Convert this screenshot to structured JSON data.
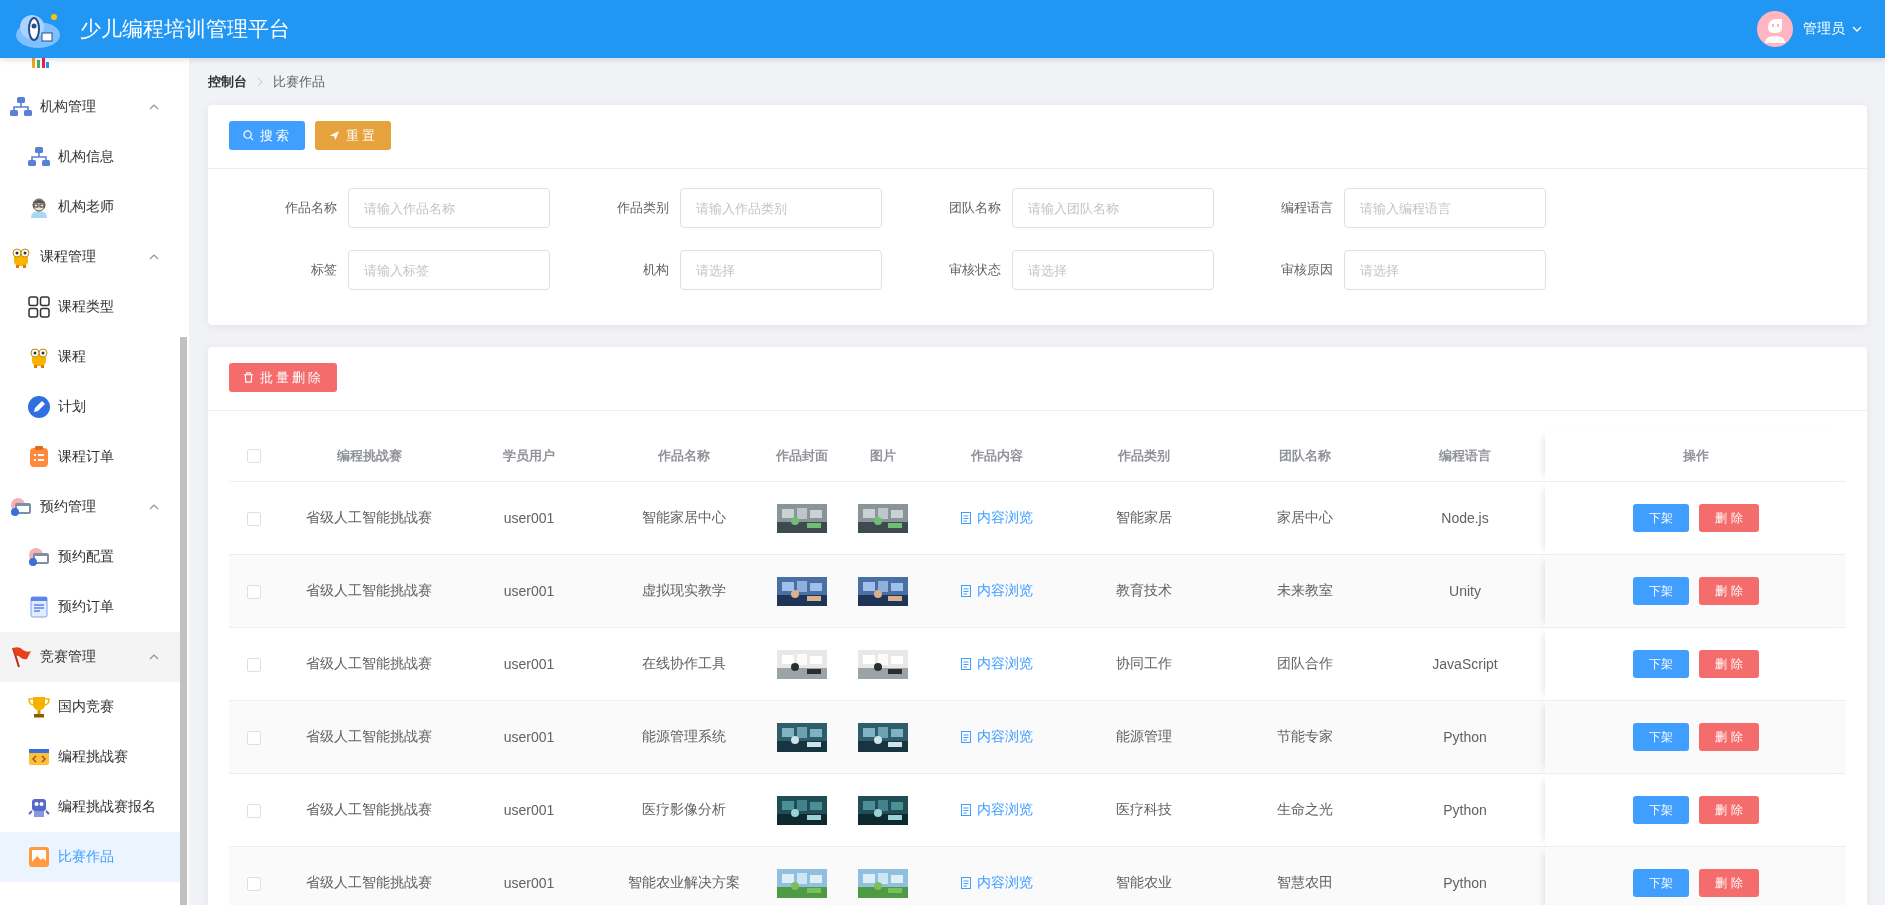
{
  "header": {
    "title": "少儿编程培训管理平台",
    "user": "管理员"
  },
  "sidebar": {
    "groups": [
      {
        "label": "机构管理",
        "expanded": true,
        "children": [
          {
            "label": "机构信息",
            "selected": false
          },
          {
            "label": "机构老师",
            "selected": false
          }
        ]
      },
      {
        "label": "课程管理",
        "expanded": true,
        "children": [
          {
            "label": "课程类型",
            "selected": false
          },
          {
            "label": "课程",
            "selected": false
          },
          {
            "label": "计划",
            "selected": false
          },
          {
            "label": "课程订单",
            "selected": false
          }
        ]
      },
      {
        "label": "预约管理",
        "expanded": true,
        "children": [
          {
            "label": "预约配置",
            "selected": false
          },
          {
            "label": "预约订单",
            "selected": false
          }
        ]
      },
      {
        "label": "竞赛管理",
        "expanded": true,
        "children": [
          {
            "label": "国内竞赛",
            "selected": false
          },
          {
            "label": "编程挑战赛",
            "selected": false
          },
          {
            "label": "编程挑战赛报名",
            "selected": false
          },
          {
            "label": "比赛作品",
            "selected": true
          }
        ]
      }
    ]
  },
  "breadcrumb": [
    "控制台",
    "比赛作品"
  ],
  "search_buttons": [
    {
      "label": "搜索",
      "kind": "search"
    },
    {
      "label": "重置",
      "kind": "reset"
    }
  ],
  "filters": [
    {
      "label": "作品名称",
      "placeholder": "请输入作品名称"
    },
    {
      "label": "作品类别",
      "placeholder": "请输入作品类别"
    },
    {
      "label": "团队名称",
      "placeholder": "请输入团队名称"
    },
    {
      "label": "编程语言",
      "placeholder": "请输入编程语言"
    },
    {
      "label": "标签",
      "placeholder": "请输入标签"
    },
    {
      "label": "机构",
      "placeholder": "请选择"
    },
    {
      "label": "审核状态",
      "placeholder": "请选择"
    },
    {
      "label": "审核原因",
      "placeholder": "请选择"
    }
  ],
  "batch_delete": "批量删除",
  "table": {
    "all_checked": false,
    "columns": [
      {
        "label": "编程挑战赛",
        "kind": "text"
      },
      {
        "label": "学员用户",
        "kind": "text"
      },
      {
        "label": "作品名称",
        "kind": "text"
      },
      {
        "label": "作品封面",
        "kind": "picture"
      },
      {
        "label": "图片",
        "kind": "picture"
      },
      {
        "label": "作品内容",
        "kind": "link"
      },
      {
        "label": "作品类别",
        "kind": "text"
      },
      {
        "label": "团队名称",
        "kind": "text"
      },
      {
        "label": "编程语言",
        "kind": "text"
      },
      {
        "label": "操作",
        "kind": "actions"
      }
    ],
    "rows": [
      {
        "checked": false,
        "cells": [
          "省级人工智能挑战赛",
          "user001",
          "智能家居中心",
          {
            "kind": "picture"
          },
          {
            "kind": "picture"
          },
          "内容浏览",
          "智能家居",
          "家居中心",
          "Node.js",
          [
            {
              "label": "下架",
              "kind": "primary"
            },
            {
              "label": "删除",
              "kind": "danger"
            }
          ]
        ]
      },
      {
        "checked": false,
        "cells": [
          "省级人工智能挑战赛",
          "user001",
          "虚拟现实教学",
          {
            "kind": "picture"
          },
          {
            "kind": "picture"
          },
          "内容浏览",
          "教育技术",
          "未来教室",
          "Unity",
          [
            {
              "label": "下架",
              "kind": "primary"
            },
            {
              "label": "删除",
              "kind": "danger"
            }
          ]
        ]
      },
      {
        "checked": false,
        "cells": [
          "省级人工智能挑战赛",
          "user001",
          "在线协作工具",
          {
            "kind": "picture"
          },
          {
            "kind": "picture"
          },
          "内容浏览",
          "协同工作",
          "团队合作",
          "JavaScript",
          [
            {
              "label": "下架",
              "kind": "primary"
            },
            {
              "label": "删除",
              "kind": "danger"
            }
          ]
        ]
      },
      {
        "checked": false,
        "cells": [
          "省级人工智能挑战赛",
          "user001",
          "能源管理系统",
          {
            "kind": "picture"
          },
          {
            "kind": "picture"
          },
          "内容浏览",
          "能源管理",
          "节能专家",
          "Python",
          [
            {
              "label": "下架",
              "kind": "primary"
            },
            {
              "label": "删除",
              "kind": "danger"
            }
          ]
        ]
      },
      {
        "checked": false,
        "cells": [
          "省级人工智能挑战赛",
          "user001",
          "医疗影像分析",
          {
            "kind": "picture"
          },
          {
            "kind": "picture"
          },
          "内容浏览",
          "医疗科技",
          "生命之光",
          "Python",
          [
            {
              "label": "下架",
              "kind": "primary"
            },
            {
              "label": "删除",
              "kind": "danger"
            }
          ]
        ]
      },
      {
        "checked": false,
        "cells": [
          "省级人工智能挑战赛",
          "user001",
          "智能农业解决方案",
          {
            "kind": "picture"
          },
          {
            "kind": "picture"
          },
          "内容浏览",
          "智能农业",
          "智慧农田",
          "Python",
          [
            {
              "label": "下架",
              "kind": "primary"
            },
            {
              "label": "删除",
              "kind": "danger"
            }
          ]
        ]
      }
    ]
  }
}
